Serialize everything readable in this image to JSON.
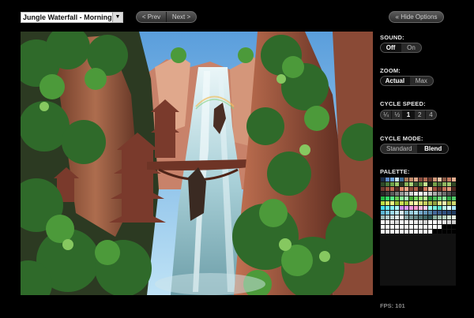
{
  "scene": {
    "selected": "Jungle Waterfall - Morning"
  },
  "nav": {
    "prev_label": "< Prev",
    "next_label": "Next >"
  },
  "options": {
    "hide_label": "« Hide Options"
  },
  "sound": {
    "label": "SOUND:",
    "options": [
      "Off",
      "On"
    ],
    "selected": "Off"
  },
  "zoom": {
    "label": "ZOOM:",
    "options": [
      "Actual",
      "Max"
    ],
    "selected": "Actual"
  },
  "cycle_speed": {
    "label": "CYCLE SPEED:",
    "options": [
      "¼",
      "½",
      "1",
      "2",
      "4"
    ],
    "selected": "1"
  },
  "cycle_mode": {
    "label": "CYCLE MODE:",
    "options": [
      "Standard",
      "Blend"
    ],
    "selected": "Blend"
  },
  "palette": {
    "label": "PALETTE:",
    "colors": [
      "#1a2d4a",
      "#5a86c4",
      "#6fa5dd",
      "#c9e3f5",
      "#3f6d96",
      "#a87a5a",
      "#c48b6b",
      "#e0a98b",
      "#874c3e",
      "#b36b52",
      "#6a3a2e",
      "#d29a7a",
      "#f0c5a5",
      "#8b5a45",
      "#c47a60",
      "#e8b090",
      "#2e4a2a",
      "#4a7a3a",
      "#6ea24a",
      "#9bc86a",
      "#2a3a22",
      "#86b45a",
      "#aad27a",
      "#3a5a30",
      "#5d8c3f",
      "#c3e28f",
      "#1d2b18",
      "#74a048",
      "#4c6e38",
      "#8fb860",
      "#a0c870",
      "#304826",
      "#703a30",
      "#9c5440",
      "#c06a50",
      "#5a2e26",
      "#e08a6a",
      "#f4a888",
      "#8a4a3a",
      "#b46048",
      "#3e2018",
      "#d47a5c",
      "#fcc0a0",
      "#a24e3c",
      "#6e3428",
      "#c8745a",
      "#e49a7c",
      "#502820",
      "#2a2a2a",
      "#404040",
      "#5a5a5a",
      "#787878",
      "#969696",
      "#b4b4b4",
      "#d2d2d2",
      "#f0f0f0",
      "#ffffff",
      "#e6e6e6",
      "#c8c8c8",
      "#aaaaaa",
      "#8c8c8c",
      "#6e6e6e",
      "#505050",
      "#323232",
      "#22bb44",
      "#33dd66",
      "#55ee88",
      "#66cc55",
      "#88ff99",
      "#aaffbb",
      "#44aa33",
      "#77dd66",
      "#99ee77",
      "#bbff99",
      "#2a9a3a",
      "#4ac05a",
      "#6ad87a",
      "#8af09a",
      "#30a848",
      "#50c868",
      "#bbdd44",
      "#ddee66",
      "#eeff88",
      "#99bb33",
      "#ccdd55",
      "#aacc44",
      "#eeee99",
      "#ffffaa",
      "#dde077",
      "#c8d060",
      "#b0c050",
      "#90a040",
      "#e0ea88",
      "#f2f6b0",
      "#a8b848",
      "#d0da70",
      "#44ddee",
      "#66eeff",
      "#88f4ff",
      "#aaf8ff",
      "#cc88ee",
      "#dd99ff",
      "#ee99dd",
      "#ff99cc",
      "#ffbbdd",
      "#ffccee",
      "#99ffee",
      "#77eedd",
      "#55ddcc",
      "#bbffee",
      "#ddffff",
      "#a8e8f8",
      "#5ab4d4",
      "#7ac8e4",
      "#9ad8ee",
      "#bce6f4",
      "#d8f0fa",
      "#88bbcc",
      "#99ccdd",
      "#aaddee",
      "#77aacc",
      "#6699bb",
      "#5588aa",
      "#446699",
      "#3a5a88",
      "#305080",
      "#284670",
      "#203c60",
      "#9ab8b8",
      "#b0c8c8",
      "#c6d8d8",
      "#dce8e8",
      "#f2f8f8",
      "#88a8a8",
      "#769898",
      "#648888",
      "#527878",
      "#406868",
      "#305858",
      "#8ab0a0",
      "#a0c0b0",
      "#b6d0c0",
      "#cce0d0",
      "#e2f0e0",
      "#ffffff",
      "#f4f4f4",
      "#e8e8e8",
      "#dcdcdc",
      "#ffffff",
      "#ffffff",
      "#f8f8f8",
      "#ececec",
      "#e0e0e0",
      "#d4d4d4",
      "#ffffff",
      "#fafafa",
      "#efefef",
      "#e4e4e4",
      "#d8d8d8",
      "#cccccc",
      "#ffffff",
      "#ffffff",
      "#ffffff",
      "#ffffff",
      "#ffffff",
      "#ffffff",
      "#ffffff",
      "#ffffff",
      "#ffffff",
      "#ffffff",
      "#ffffff",
      "#ffffff",
      "#ffffff",
      "#000000",
      "#000000",
      "#000000",
      "#ffffff",
      "#ffffff",
      "#ffffff",
      "#ffffff",
      "#ffffff",
      "#ffffff",
      "#ffffff",
      "#ffffff",
      "#ffffff",
      "#ffffff",
      "#ffffff",
      "#000000",
      "#000000",
      "#000000",
      "#000000",
      "#000000"
    ]
  },
  "fps": {
    "text": "FPS: 101"
  }
}
